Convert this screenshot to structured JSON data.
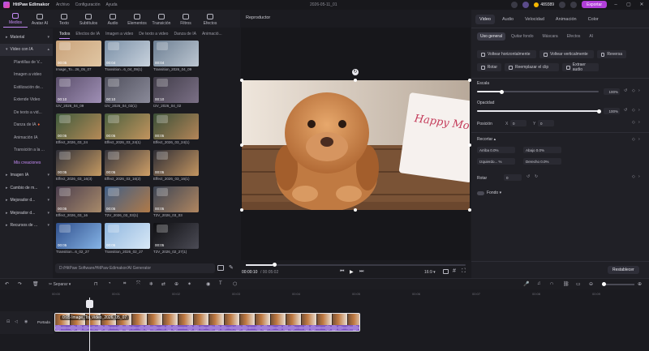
{
  "titlebar": {
    "app_name": "HitPaw Edimakor",
    "menus": [
      "Archivo",
      "Configuración",
      "Ayuda"
    ],
    "document_title": "2026-05-11_01",
    "credits": "489389",
    "export_label": "Exportar",
    "accent_color": "#b13fd8"
  },
  "media_tabs": [
    {
      "label": "Medios",
      "icon": "media-icon",
      "active": true
    },
    {
      "label": "Avatar AI",
      "icon": "avatar-icon"
    },
    {
      "label": "Texto",
      "icon": "text-icon"
    },
    {
      "label": "Subtítulos",
      "icon": "subtitles-icon"
    },
    {
      "label": "Audio",
      "icon": "audio-icon"
    },
    {
      "label": "Elementos",
      "icon": "elements-icon"
    },
    {
      "label": "Transición",
      "icon": "transition-icon"
    },
    {
      "label": "Filtros",
      "icon": "filters-icon"
    },
    {
      "label": "Efectos",
      "icon": "effects-icon"
    }
  ],
  "sidebar": {
    "items": [
      {
        "label": "Material",
        "type": "group"
      },
      {
        "label": "Video con IA",
        "type": "group",
        "selected": true
      },
      {
        "label": "Plantillas de V...",
        "type": "sub"
      },
      {
        "label": "Imagen a video",
        "type": "sub"
      },
      {
        "label": "Estilización de...",
        "type": "sub"
      },
      {
        "label": "Extende Video",
        "type": "sub"
      },
      {
        "label": "De texto a vid...",
        "type": "sub"
      },
      {
        "label": "Danza de IA",
        "type": "sub"
      },
      {
        "label": "Animación IA",
        "type": "sub"
      },
      {
        "label": "Transición a la ...",
        "type": "sub"
      },
      {
        "label": "Mis creaciones",
        "type": "sub",
        "active": true
      },
      {
        "label": "Imagen IA",
        "type": "group"
      },
      {
        "label": "Cambio de m...",
        "type": "group"
      },
      {
        "label": "Mejorador d...",
        "type": "group"
      },
      {
        "label": "Mejorador d...",
        "type": "group"
      },
      {
        "label": "Recursos de ...",
        "type": "group"
      }
    ]
  },
  "category_tabs": [
    "Todos",
    "Efectos de IA",
    "Imagen a video",
    "De texto a video",
    "Danza de IA",
    "Animació..."
  ],
  "media_items": [
    {
      "label": "Image_To...26_05_07",
      "duration": "00:05"
    },
    {
      "label": "Transition...6_04_09(1)",
      "duration": "00:04"
    },
    {
      "label": "Transition_2026_04_09",
      "duration": "00:04"
    },
    {
      "label": "I2V_2026_04_09",
      "duration": "00:10"
    },
    {
      "label": "I2V_2026_04_02(1)",
      "duration": "00:10"
    },
    {
      "label": "I2V_2026_04_02",
      "duration": "00:10"
    },
    {
      "label": "Effect_2026_03_24",
      "duration": "00:05"
    },
    {
      "label": "Effect_2026_03_24(1)",
      "duration": "00:05"
    },
    {
      "label": "Effect_2026_03_24(1)",
      "duration": "00:05"
    },
    {
      "label": "Effect_2026_03_16(3)",
      "duration": "00:05"
    },
    {
      "label": "Effect_2026_03_16(2)",
      "duration": "00:05"
    },
    {
      "label": "Effect_2026_03_16(1)",
      "duration": "00:05"
    },
    {
      "label": "Effect_2026_03_16",
      "duration": "00:05"
    },
    {
      "label": "T2V_2026_03_03(1)",
      "duration": "00:05"
    },
    {
      "label": "T2V_2026_03_03",
      "duration": "00:05"
    },
    {
      "label": "Transition...6_02_27",
      "duration": "00:05"
    },
    {
      "label": "Transition_2026_02_27",
      "duration": "00:05"
    },
    {
      "label": "T2V_2026_02_27(1)",
      "duration": "00:05"
    }
  ],
  "path_bar": "D:/HitPaw Software/HitPaw Edimakor/AI Generator",
  "preview": {
    "title": "Reproductor",
    "current_time": "00:00:10",
    "total_time": "/ 00:05:02",
    "aspect": "16:9",
    "card_text": "Happy Mother's Day"
  },
  "right_panel": {
    "tabs": [
      "Video",
      "Audio",
      "Velocidad",
      "Animación",
      "Color"
    ],
    "subtabs": [
      "Uso general",
      "Quitar fondo",
      "Máscara",
      "Efectos",
      "AI"
    ],
    "buttons": [
      {
        "label": "Voltear horizontalmente",
        "icon": "flip-h-icon"
      },
      {
        "label": "Voltear verticalmente",
        "icon": "flip-v-icon"
      },
      {
        "label": "Reversa",
        "icon": "reverse-icon"
      },
      {
        "label": "Rotar",
        "icon": "rotate-icon"
      },
      {
        "label": "Reemplazar el clip",
        "icon": "replace-icon"
      },
      {
        "label": "Extraer audio",
        "icon": "extract-audio-icon"
      }
    ],
    "scale": {
      "label": "Escala",
      "value": "100%",
      "fraction": 0.2
    },
    "opacity": {
      "label": "Opacidad",
      "value": "100%",
      "fraction": 1.0
    },
    "position": {
      "label": "Posición",
      "x_label": "X",
      "x_value": "0",
      "y_label": "Y",
      "y_value": "0"
    },
    "crop": {
      "label": "Recortar",
      "fields": [
        {
          "label": "Arriba",
          "value": "0.0%"
        },
        {
          "label": "Abajo",
          "value": "0.0%"
        },
        {
          "label": "Izquierdo...",
          "value": "%"
        },
        {
          "label": "Derecho",
          "value": "0.0%"
        }
      ]
    },
    "rotate": {
      "label": "Rotar",
      "value": "0"
    },
    "background": {
      "label": "Fondo"
    },
    "reset_label": "Restablecer"
  },
  "timeline": {
    "split_label": "Separar",
    "track_label": "Portada",
    "clip_label": "0:05  Image_To_Video_2026_05_07",
    "ruler": [
      "00:00",
      "00:01",
      "00:02",
      "00:03",
      "00:04",
      "00:05",
      "00:06",
      "00:07",
      "00:08",
      "00:09"
    ]
  }
}
